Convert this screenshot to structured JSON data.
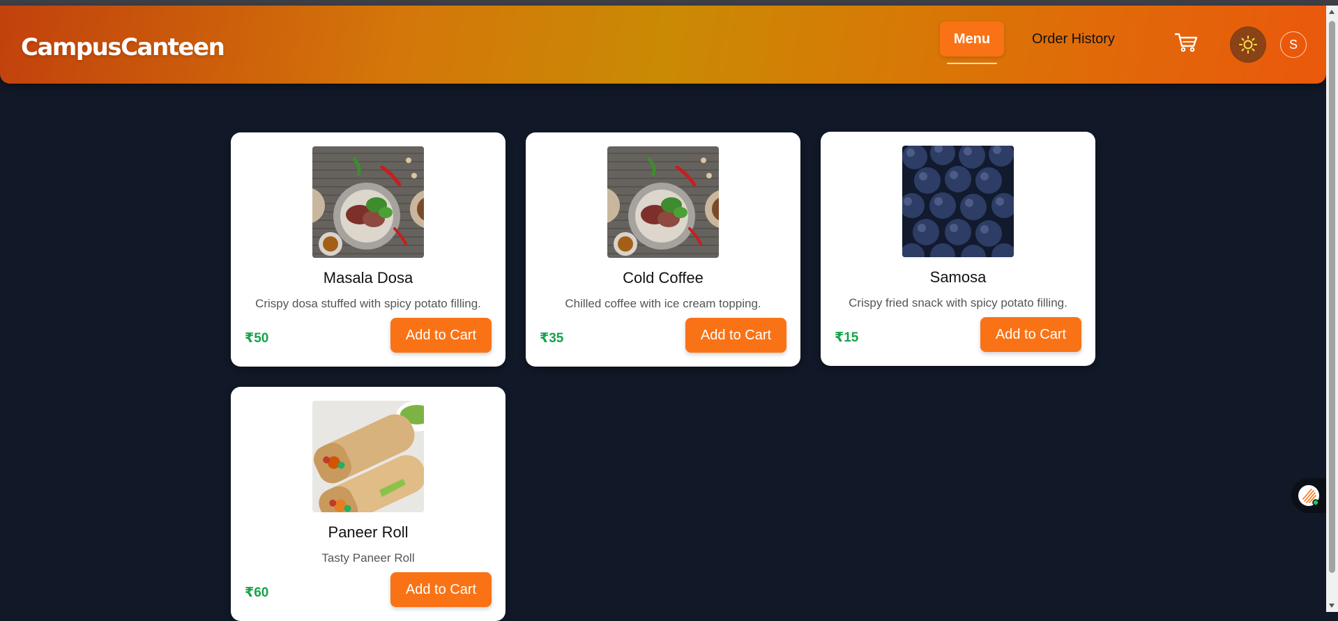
{
  "app": {
    "logo": "CampusCanteen"
  },
  "nav": {
    "menu_label": "Menu",
    "order_history_label": "Order History",
    "avatar_initial": "S"
  },
  "colors": {
    "accent": "#f97316",
    "price": "#16a34a",
    "background": "#111827",
    "card": "#ffffff"
  },
  "icons": {
    "cart": "cart-icon",
    "theme": "sun-icon",
    "chat": "chat-assistant-icon"
  },
  "menu_items": [
    {
      "name": "Masala Dosa",
      "description": "Crispy dosa stuffed with spicy potato filling.",
      "price": "₹50",
      "button_label": "Add to Cart",
      "image": "plated-meal-photo"
    },
    {
      "name": "Cold Coffee",
      "description": "Chilled coffee with ice cream topping.",
      "price": "₹35",
      "button_label": "Add to Cart",
      "image": "plated-meal-photo"
    },
    {
      "name": "Samosa",
      "description": "Crispy fried snack with spicy potato filling.",
      "price": "₹15",
      "button_label": "Add to Cart",
      "image": "blueberries-photo"
    },
    {
      "name": "Paneer Roll",
      "description": "Tasty Paneer Roll",
      "price": "₹60",
      "button_label": "Add to Cart",
      "image": "paneer-wrap-photo"
    }
  ]
}
